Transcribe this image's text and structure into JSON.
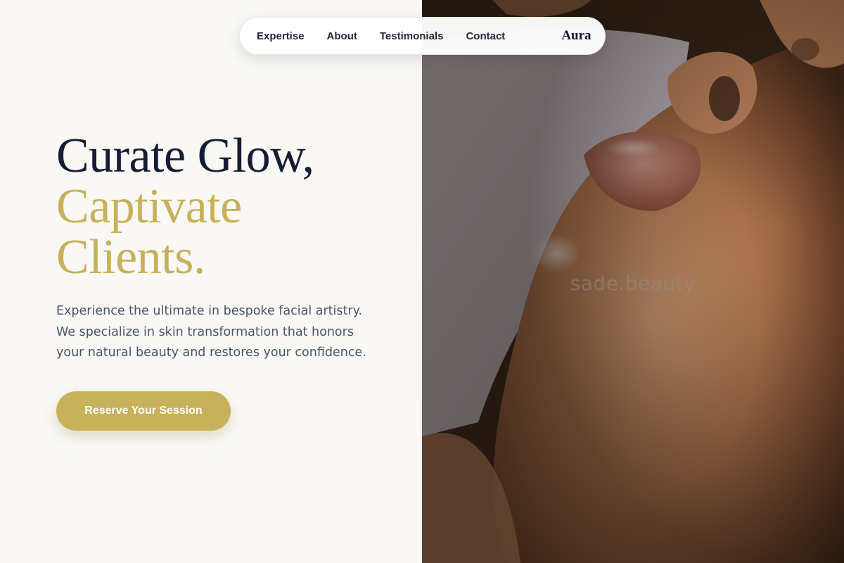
{
  "nav": {
    "links": [
      "Expertise",
      "About",
      "Testimonials",
      "Contact"
    ],
    "brand": "Aura"
  },
  "hero": {
    "headline": {
      "line1": "Curate Glow,",
      "line2": "Captivate",
      "line3": "Clients."
    },
    "description": {
      "line1": "Experience the ultimate in bespoke facial artistry.",
      "line2": "We specialize in skin transformation that honors",
      "line3": "your natural beauty and restores your confidence."
    },
    "cta_label": "Reserve Your Session"
  },
  "photo": {
    "watermark": "sade.beauty"
  },
  "colors": {
    "background": "#f9f8f5",
    "headline_dark": "#141c33",
    "accent_gold": "#c7b15a",
    "body_text": "#4a5468"
  }
}
